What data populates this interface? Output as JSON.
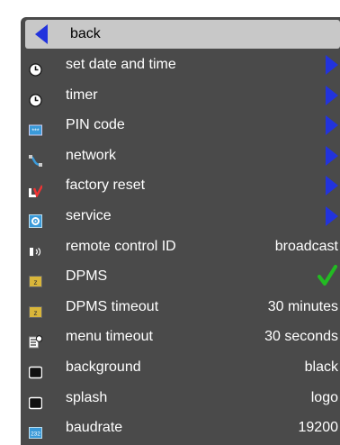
{
  "menu": {
    "back_label": "back",
    "items": [
      {
        "icon": "clock-icon",
        "label": "set date and time",
        "value": "",
        "control": "submenu-arrow"
      },
      {
        "icon": "clock-icon",
        "label": "timer",
        "value": "",
        "control": "submenu-arrow"
      },
      {
        "icon": "pin-keypad-icon",
        "label": "PIN code",
        "value": "",
        "control": "submenu-arrow"
      },
      {
        "icon": "network-cable-icon",
        "label": "network",
        "value": "",
        "control": "submenu-arrow"
      },
      {
        "icon": "factory-reset-icon",
        "label": "factory reset",
        "value": "",
        "control": "submenu-arrow"
      },
      {
        "icon": "service-icon",
        "label": "service",
        "value": "",
        "control": "submenu-arrow"
      },
      {
        "icon": "remote-control-icon",
        "label": "remote control ID",
        "value": "broadcast",
        "control": "value"
      },
      {
        "icon": "dpms-icon",
        "label": "DPMS",
        "value": "",
        "control": "checkmark"
      },
      {
        "icon": "dpms-icon",
        "label": "DPMS timeout",
        "value": "30 minutes",
        "control": "value"
      },
      {
        "icon": "menu-timeout-icon",
        "label": "menu timeout",
        "value": "30 seconds",
        "control": "value"
      },
      {
        "icon": "background-icon",
        "label": "background",
        "value": "black",
        "control": "value"
      },
      {
        "icon": "background-icon",
        "label": "splash",
        "value": "logo",
        "control": "value"
      },
      {
        "icon": "baudrate-232-icon",
        "label": "baudrate",
        "value": "19200",
        "control": "value"
      }
    ]
  },
  "colors": {
    "panel": "#4a4a4a",
    "selected_row": "#c8c8c8",
    "arrow": "#2233dd",
    "check": "#22bb22",
    "text": "#ffffff"
  }
}
